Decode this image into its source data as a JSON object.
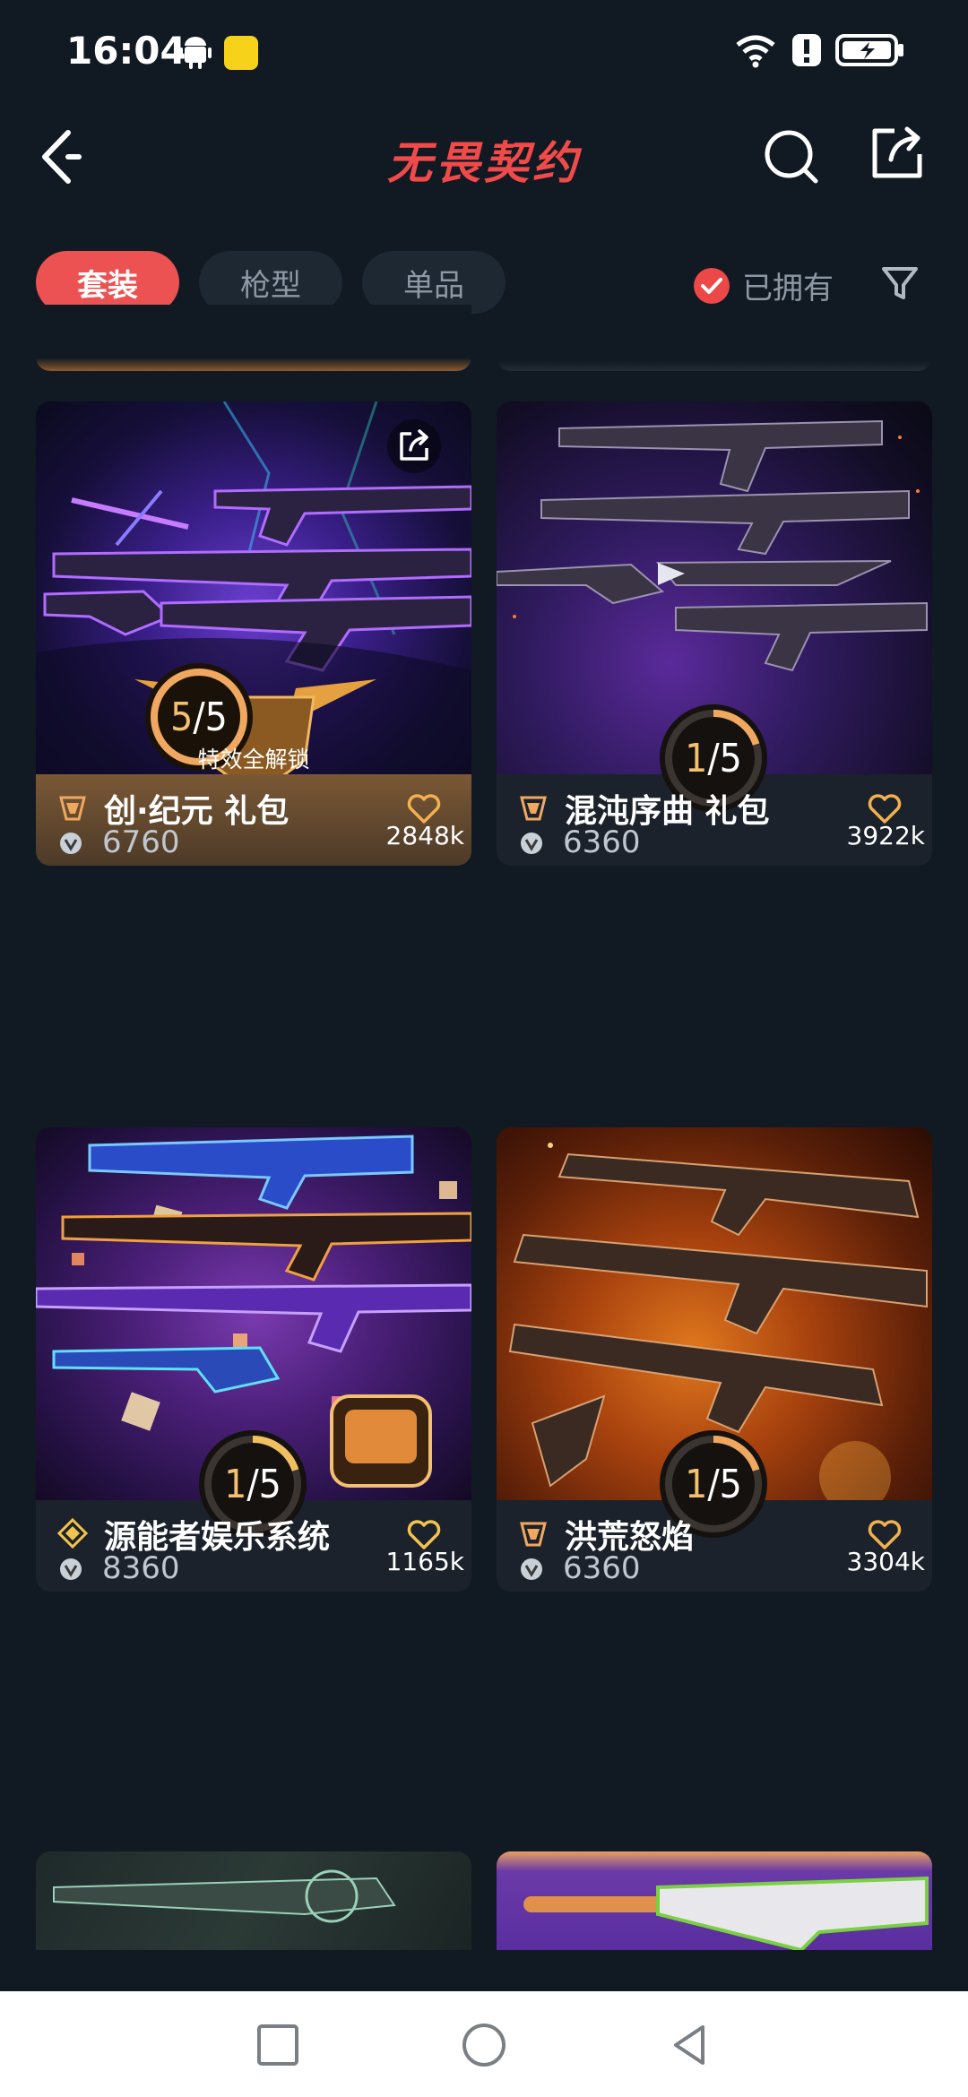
{
  "status_bar": {
    "time": "16:04"
  },
  "header": {
    "title": "无畏契约"
  },
  "filters": {
    "tabs": [
      {
        "label": "套装",
        "active": true
      },
      {
        "label": "枪型",
        "active": false
      },
      {
        "label": "单品",
        "active": false
      }
    ],
    "owned_label": "已拥有",
    "owned_checked": true
  },
  "cards": [
    {
      "name": "创·纪元 礼包",
      "price": "6760",
      "likes": "2848k",
      "progress_current": "5",
      "progress_total": "5",
      "progress_fraction": 1.0,
      "unlock_label": "特效全解锁",
      "highlight": true
    },
    {
      "name": "混沌序曲 礼包",
      "price": "6360",
      "likes": "3922k",
      "progress_current": "1",
      "progress_total": "5",
      "progress_fraction": 0.2
    },
    {
      "name": "源能者娱乐系统",
      "price": "8360",
      "likes": "1165k",
      "progress_current": "1",
      "progress_total": "5",
      "progress_fraction": 0.2
    },
    {
      "name": "洪荒怒焰",
      "price": "6360",
      "likes": "3304k",
      "progress_current": "1",
      "progress_total": "5",
      "progress_fraction": 0.2
    }
  ],
  "colors": {
    "accent": "#ec5252",
    "background": "#111922",
    "progress": "#f0a860",
    "heart": "#f2b04e"
  },
  "icons": [
    "back-arrow-icon",
    "search-icon",
    "share-icon",
    "check-icon",
    "filter-icon",
    "tier-icon",
    "heart-icon",
    "vp-coin-icon",
    "square-icon",
    "circle-icon",
    "triangle-back-icon"
  ]
}
